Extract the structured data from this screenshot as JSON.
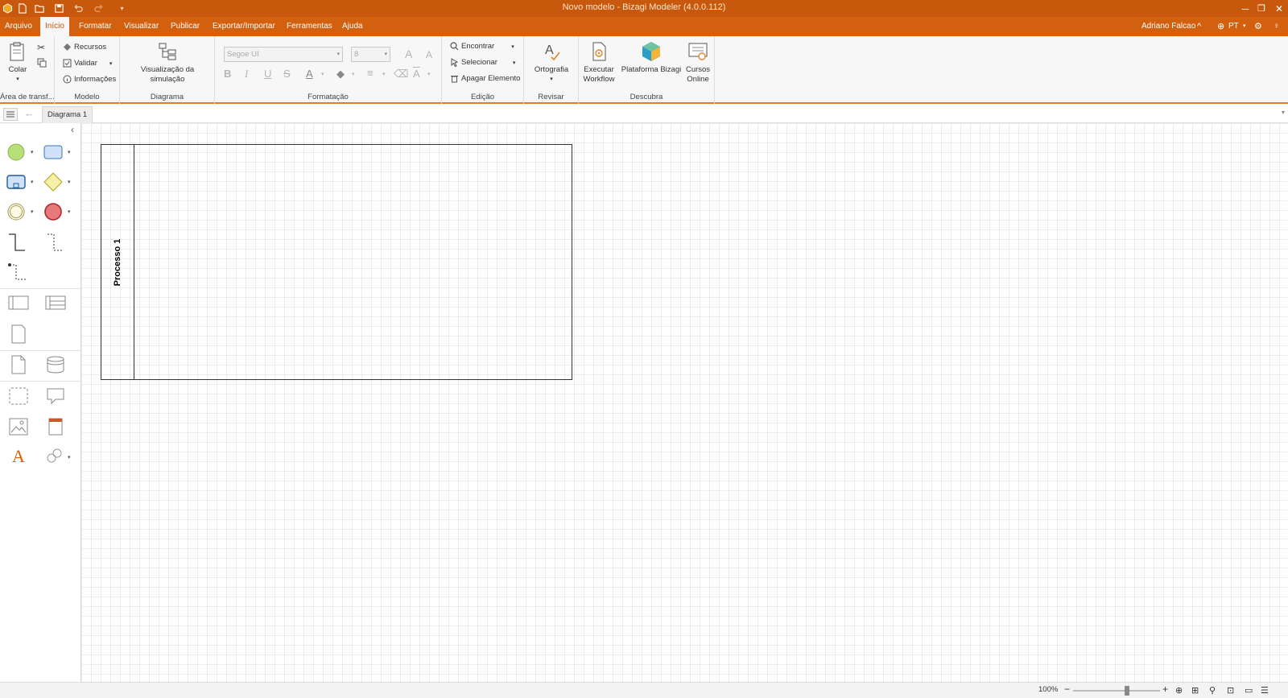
{
  "titlebar": {
    "title": "Novo modelo - Bizagi Modeler (4.0.0.112)"
  },
  "menu": {
    "items": [
      "Arquivo",
      "Início",
      "Formatar",
      "Visualizar",
      "Publicar",
      "Exportar/Importar",
      "Ferramentas",
      "Ajuda"
    ],
    "active": "Início",
    "user": "Adriano Falcao",
    "language": "PT"
  },
  "ribbon": {
    "clipboard": {
      "paste": "Colar",
      "label": "Área de transf..."
    },
    "model": {
      "resources": "Recursos",
      "validate": "Validar",
      "info": "Informações",
      "label": "Modelo"
    },
    "diagram": {
      "simulation": "Visualização da simulação",
      "label": "Diagrama"
    },
    "format": {
      "font": "Segoe UI",
      "size": "8",
      "label": "Formatação"
    },
    "edit": {
      "find": "Encontrar",
      "select": "Selecionar",
      "delete": "Apagar Elemento",
      "label": "Edição"
    },
    "review": {
      "spelling": "Ortografia",
      "label": "Revisar"
    },
    "discover": {
      "workflow_1": "Executar",
      "workflow_2": "Workflow",
      "platform": "Plataforma Bizagi",
      "courses_1": "Cursos",
      "courses_2": "Online",
      "label": "Descubra"
    }
  },
  "tabs": {
    "diagram": "Diagrama 1"
  },
  "canvas": {
    "pool_name": "Processo 1"
  },
  "status": {
    "zoom": "100%",
    "zoom_level": 100
  },
  "colors": {
    "brand": "#c8580b",
    "menubar": "#d2600f",
    "start_event": "#b8e07a",
    "task": "#cfe2f7",
    "gateway": "#f6f0a8",
    "end_event": "#e8797b"
  }
}
